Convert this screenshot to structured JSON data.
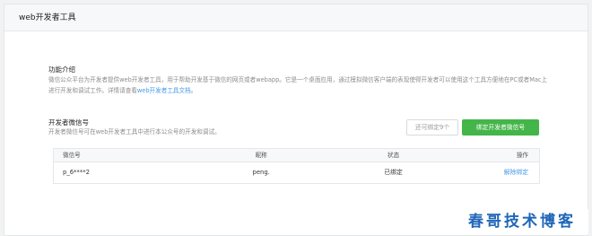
{
  "header": {
    "title": "web开发者工具"
  },
  "intro": {
    "title": "功能介绍",
    "desc_before_link": "微信公众平台为开发者提供web开发者工具，用于帮助开发基于微信的网页或者webapp。它是一个桌面应用，通过模拟微信客户端的表现使得开发者可以使用这个工具方便地在PC或者Mac上进行开发和调试工作。详情请查看",
    "link": "web开发者工具文档",
    "desc_after_link": "。"
  },
  "developers": {
    "title": "开发者微信号",
    "desc": "开发者微信号可在web开发者工具中进行本公众号的开发和调试。",
    "remaining": "还可绑定9个",
    "bind_button": "绑定开发者微信号",
    "columns": [
      "微信号",
      "昵称",
      "状态",
      "操作"
    ],
    "rows": [
      {
        "wechat_id": "p_6****2",
        "nickname": "peng.",
        "status": "已绑定",
        "action": "解除绑定"
      }
    ]
  },
  "watermark": "春哥技术博客",
  "colors": {
    "accent_green": "#44b549",
    "link_blue": "#459ae9",
    "watermark_blue": "#1f66b8"
  }
}
